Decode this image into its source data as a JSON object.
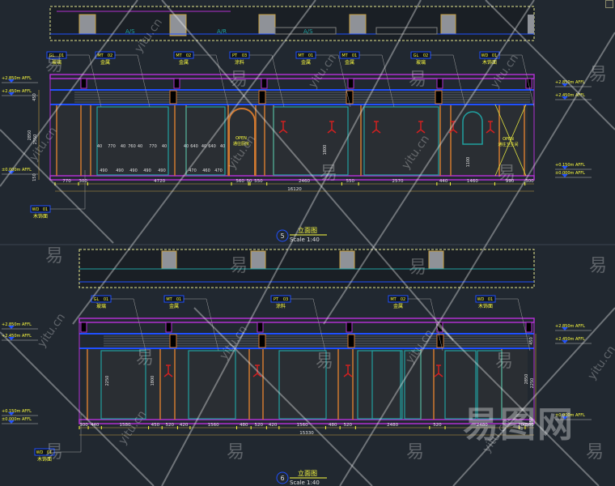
{
  "colors": {
    "background": "#212830",
    "ceiling": "#b030d0",
    "blue": "#2050ff",
    "wood": "#d07830",
    "teal": "#20a0a0",
    "red": "#d02020",
    "yellow": "#ffff40",
    "dim": "#c8a040"
  },
  "elevation5": {
    "number": "5",
    "title": "立面图",
    "scale": "Scale  1:40",
    "tags": [
      {
        "code": "GL",
        "num": "01",
        "name": "玻璃"
      },
      {
        "code": "MT",
        "num": "02",
        "name": "金属"
      },
      {
        "code": "MT",
        "num": "02",
        "name": "金属"
      },
      {
        "code": "PT",
        "num": "03",
        "name": "涂料"
      },
      {
        "code": "MT",
        "num": "01",
        "name": "金属"
      },
      {
        "code": "MT",
        "num": "01",
        "name": "金属"
      },
      {
        "code": "GL",
        "num": "02",
        "name": "玻璃"
      },
      {
        "code": "WD",
        "num": "01",
        "name": "木饰面"
      }
    ],
    "bottom_tag": {
      "code": "WD",
      "num": "01",
      "name": "木饰面"
    },
    "levels_left": [
      "+2.850m AFFL",
      "+2.450m AFFL",
      "±0.000m AFFL"
    ],
    "levels_right": [
      "+2.850m AFFL",
      "+2.450m AFFL",
      "+0.150m AFFL",
      "±0.000m AFFL"
    ],
    "dims": [
      770,
      300,
      4720,
      560,
      50,
      550,
      2460,
      550,
      2570,
      440,
      1460,
      990,
      300
    ],
    "total": "16120",
    "vertical_dims": [
      "450",
      "2850",
      "2550",
      "150"
    ],
    "inner_dims": [
      "40",
      "770",
      "40",
      "760",
      "40",
      "770",
      "40",
      "40",
      "640",
      "40",
      "640",
      "40",
      "490",
      "490",
      "490",
      "490",
      "490",
      "470",
      "460",
      "470",
      "1800",
      "1100"
    ],
    "open_labels": [
      {
        "line1": "OPEN",
        "line2": "通往厨房"
      },
      {
        "line1": "OPEN",
        "line2": "通往卫生间"
      }
    ]
  },
  "elevation6": {
    "number": "6",
    "title": "立面图",
    "scale": "Scale  1:40",
    "tags": [
      {
        "code": "GL",
        "num": "01",
        "name": "玻璃"
      },
      {
        "code": "MT",
        "num": "01",
        "name": "金属"
      },
      {
        "code": "PT",
        "num": "03",
        "name": "涂料"
      },
      {
        "code": "MT",
        "num": "02",
        "name": "金属"
      },
      {
        "code": "WD",
        "num": "01",
        "name": "木饰面"
      }
    ],
    "bottom_tag": {
      "code": "WD",
      "num": "01",
      "name": "木饰面"
    },
    "levels_left": [
      "+2.850m AFFL",
      "+2.450m AFFL",
      "+0.150m AFFL",
      "±0.000m AFFL"
    ],
    "levels_right": [
      "+2.850m AFFL",
      "+2.450m AFFL",
      "±0.000m AFFL"
    ],
    "dims": [
      300,
      440,
      1580,
      450,
      520,
      420,
      1560,
      480,
      520,
      420,
      1560,
      480,
      520,
      2480,
      520,
      2480,
      200,
      300
    ],
    "total": "15330",
    "vertical_dims": [
      "450",
      "2850",
      "2250",
      "150"
    ],
    "inner_dims": [
      "2250",
      "1800"
    ]
  },
  "plan_labels": [
    "A/S",
    "A/R",
    "A/S"
  ],
  "watermark": {
    "char": "易",
    "url": "yitu.cn",
    "logo": "易图网"
  }
}
